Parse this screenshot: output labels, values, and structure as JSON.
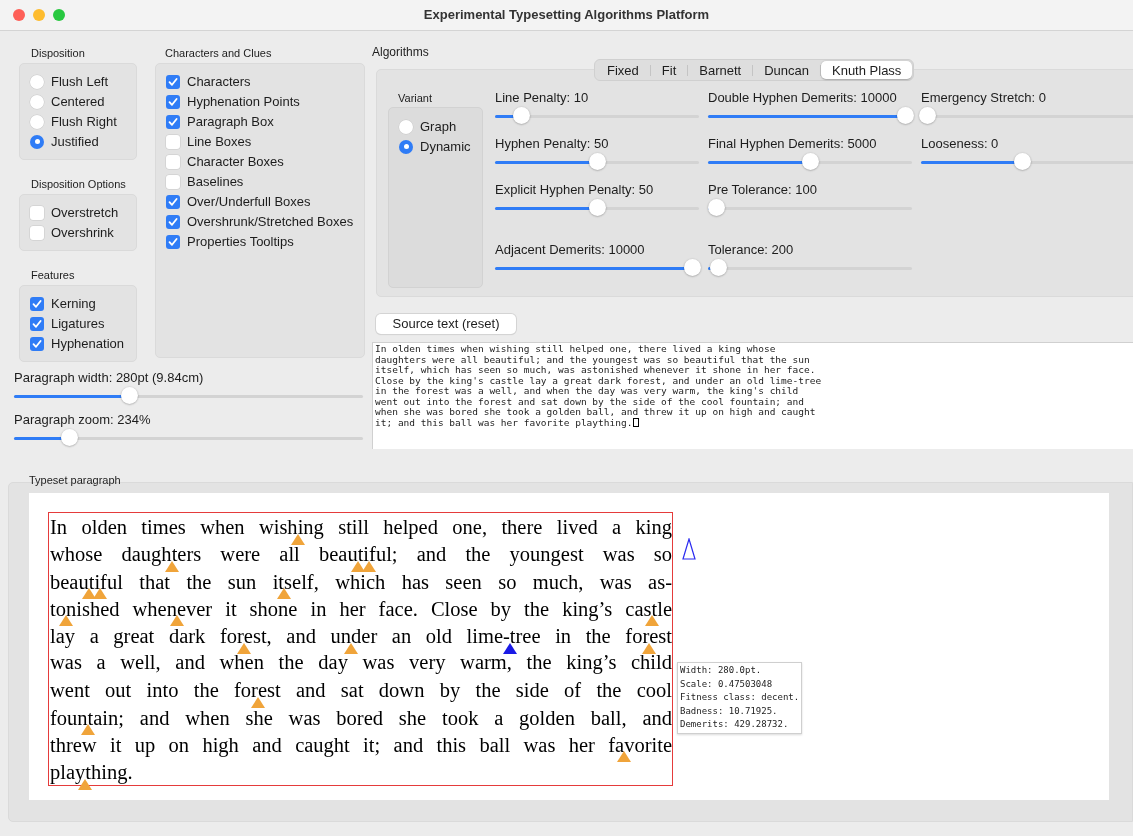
{
  "window": {
    "title": "Experimental Typesetting Algorithms Platform"
  },
  "disposition": {
    "label": "Disposition",
    "options": [
      {
        "label": "Flush Left",
        "selected": false
      },
      {
        "label": "Centered",
        "selected": false
      },
      {
        "label": "Flush Right",
        "selected": false
      },
      {
        "label": "Justified",
        "selected": true
      }
    ]
  },
  "disposition_options": {
    "label": "Disposition Options",
    "items": [
      {
        "label": "Overstretch",
        "checked": false
      },
      {
        "label": "Overshrink",
        "checked": false
      }
    ]
  },
  "features": {
    "label": "Features",
    "items": [
      {
        "label": "Kerning",
        "checked": true
      },
      {
        "label": "Ligatures",
        "checked": true
      },
      {
        "label": "Hyphenation",
        "checked": true
      }
    ]
  },
  "characters_and_clues": {
    "label": "Characters and Clues",
    "items": [
      {
        "label": "Characters",
        "checked": true
      },
      {
        "label": "Hyphenation Points",
        "checked": true
      },
      {
        "label": "Paragraph Box",
        "checked": true
      },
      {
        "label": "Line Boxes",
        "checked": false
      },
      {
        "label": "Character Boxes",
        "checked": false
      },
      {
        "label": "Baselines",
        "checked": false
      },
      {
        "label": "Over/Underfull Boxes",
        "checked": true
      },
      {
        "label": "Overshrunk/Stretched Boxes",
        "checked": true
      },
      {
        "label": "Properties Tooltips",
        "checked": true
      }
    ]
  },
  "paragraph_width": {
    "label": "Paragraph width: 280pt (9.84cm)",
    "level": 0.33
  },
  "paragraph_zoom": {
    "label": "Paragraph zoom: 234%",
    "level": 0.16
  },
  "algorithms": {
    "label": "Algorithms",
    "tabs": [
      {
        "label": "Fixed",
        "selected": false
      },
      {
        "label": "Fit",
        "selected": false
      },
      {
        "label": "Barnett",
        "selected": false
      },
      {
        "label": "Duncan",
        "selected": false
      },
      {
        "label": "Knuth Plass",
        "selected": true
      }
    ],
    "variant": {
      "label": "Variant",
      "options": [
        {
          "label": "Graph",
          "selected": false
        },
        {
          "label": "Dynamic",
          "selected": true
        }
      ]
    },
    "parameter_columns": [
      [
        {
          "label": "Line Penalty: 10",
          "level": 0.13
        },
        {
          "label": "Hyphen Penalty: 50",
          "level": 0.5
        },
        {
          "label": "Explicit Hyphen Penalty: 50",
          "level": 0.5
        },
        {
          "label": "Adjacent Demerits: 10000",
          "level": 0.97
        }
      ],
      [
        {
          "label": "Double Hyphen Demerits: 10000",
          "level": 0.97
        },
        {
          "label": "Final Hyphen Demerits: 5000",
          "level": 0.5
        },
        {
          "label": "Pre Tolerance: 100",
          "level": 0.04
        },
        {
          "label": "Tolerance: 200",
          "level": 0.05
        }
      ],
      [
        {
          "label": "Emergency Stretch: 0",
          "level": 0.03
        },
        {
          "label": "Looseness: 0",
          "level": 0.47
        }
      ]
    ]
  },
  "source": {
    "button": "Source text (reset)",
    "lines": [
      "In olden times when wishing still helped one, there lived a king whose",
      "daughters were all beautiful; and the youngest was so beautiful that the sun",
      "itself, which has seen so much, was astonished whenever it shone in her face.",
      "Close by the king's castle lay a great dark forest, and under an old lime-tree",
      "in the forest was a well, and when the day was very warm, the king's child",
      "went out into the forest and sat down by the side of the cool fountain; and",
      "when she was bored she took a golden ball, and threw it up on high and caught",
      "it; and this ball was her favorite plaything."
    ]
  },
  "typeset": {
    "label": "Typeset paragraph",
    "lines": [
      {
        "parts": [
          "In olden times when wish",
          "ing still helped one, there lived a king"
        ],
        "points": [
          {
            "selected": false
          }
        ]
      },
      {
        "parts": [
          "whose daugh",
          "ters were all beau",
          "ti",
          "ful; and the youngest was so"
        ],
        "points": [
          {
            "selected": false
          },
          {
            "selected": false
          },
          {
            "selected": false
          }
        ]
      },
      {
        "parts": [
          "beau",
          "ti",
          "ful that the sun it",
          "self, which has seen so much, was as-"
        ],
        "points": [
          {
            "selected": false
          },
          {
            "selected": false
          },
          {
            "selected": false
          }
        ]
      },
      {
        "parts": [
          "to",
          "nished when",
          "ever it shone in her face. Close by the king’s cas",
          "tle"
        ],
        "points": [
          {
            "selected": false
          },
          {
            "selected": false
          },
          {
            "selected": false
          }
        ]
      },
      {
        "parts": [
          "lay a great dark for",
          "est, and un",
          "der an old lime-",
          "tree in the for",
          "est"
        ],
        "points": [
          {
            "selected": false
          },
          {
            "selected": false
          },
          {
            "selected": true
          },
          {
            "selected": false
          }
        ]
      },
      {
        "parts": [
          "was a well, and when the day was very warm, the king’s child"
        ]
      },
      {
        "parts": [
          "went out into the for",
          "est and sat down by the side of the cool"
        ],
        "points": [
          {
            "selected": false
          }
        ]
      },
      {
        "parts": [
          "foun",
          "tain; and when she was bored she took a golden ball, and"
        ],
        "points": [
          {
            "selected": false
          }
        ]
      },
      {
        "parts": [
          "threw it up on high and caught it; and this ball was her fa",
          "vorite"
        ],
        "points": [
          {
            "selected": false
          }
        ]
      },
      {
        "parts": [
          "play",
          "thing."
        ],
        "points": [
          {
            "selected": false
          }
        ]
      }
    ],
    "tooltip": [
      "Width: 280.0pt.",
      "Scale: 0.47503048",
      "Fitness class: decent.",
      "Badness: 10.71925.",
      "Demerits: 429.28732."
    ]
  }
}
